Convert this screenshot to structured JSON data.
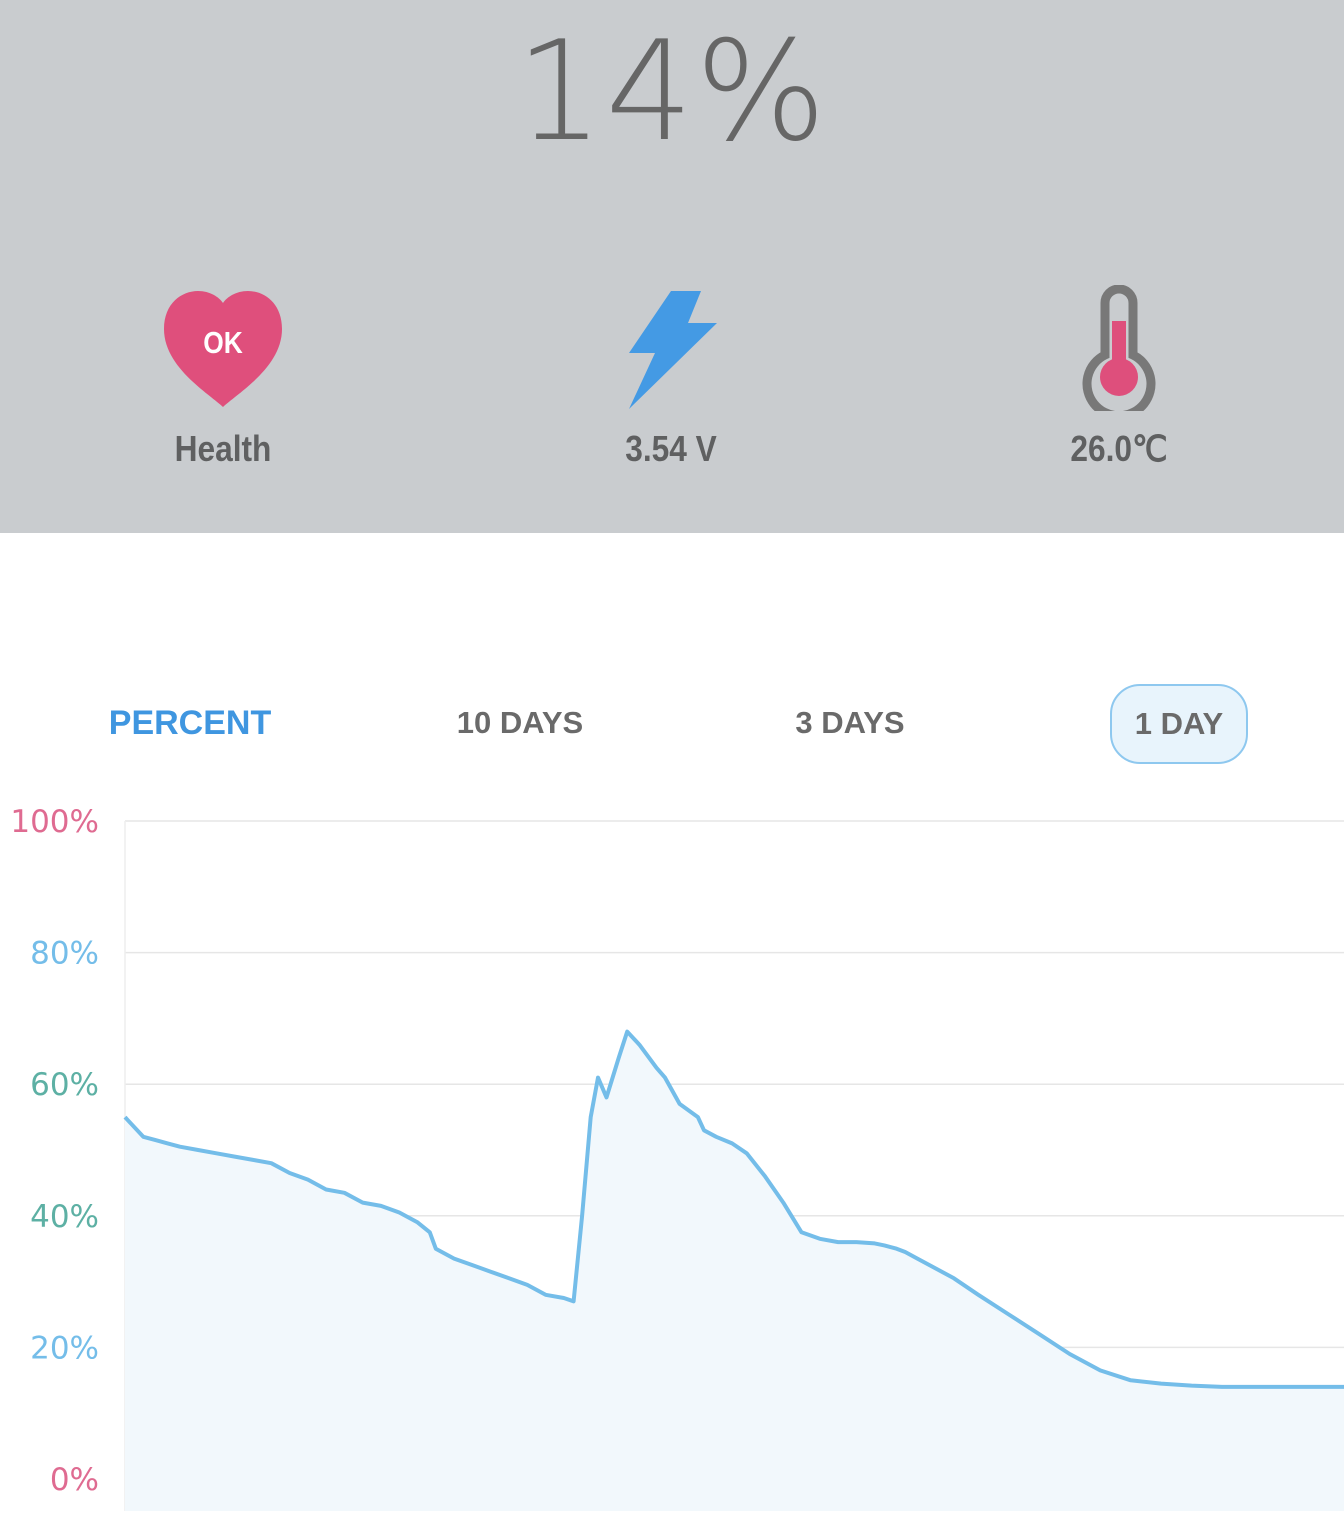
{
  "battery": {
    "percent_text": "14%"
  },
  "stats": {
    "health": {
      "badge": "OK",
      "label": "Health",
      "icon": "heart-icon"
    },
    "voltage": {
      "label": "3.54 V",
      "icon": "lightning-icon"
    },
    "temperature": {
      "label": "26.0℃",
      "icon": "thermometer-icon"
    }
  },
  "tabs": [
    {
      "label": "PERCENT"
    },
    {
      "label": "10 DAYS"
    },
    {
      "label": "3 DAYS"
    },
    {
      "label": "1 DAY",
      "selected": true
    }
  ],
  "colors": {
    "top_bg": "#c9cccf",
    "heart": "#df4f7c",
    "lightning": "#449ae4",
    "thermo_body": "#787878",
    "thermo_fill": "#de4f7c",
    "line": "#74bde9",
    "fill": "#f2f8fc",
    "accent_tab": "#3f96e0"
  },
  "chart_data": {
    "type": "area",
    "y_ticks": [
      {
        "label": "100%",
        "value": 100,
        "color": "#df6b91"
      },
      {
        "label": "80%",
        "value": 80,
        "color": "#74bde9"
      },
      {
        "label": "60%",
        "value": 60,
        "color": "#5db0a4"
      },
      {
        "label": "40%",
        "value": 40,
        "color": "#5db0a4"
      },
      {
        "label": "20%",
        "value": 20,
        "color": "#74bde9"
      },
      {
        "label": "0%",
        "value": 0,
        "color": "#df6b91"
      }
    ],
    "ylim": [
      0,
      100
    ],
    "xlim": [
      0,
      100
    ],
    "grid": true,
    "x": [
      0,
      0.5,
      1.5,
      2.5,
      3.5,
      4.5,
      6,
      7.5,
      9,
      10.5,
      12,
      13.5,
      15,
      16.5,
      18,
      19.5,
      21,
      22.5,
      24,
      25,
      25.5,
      27,
      28.5,
      30,
      31.5,
      33,
      34.5,
      36,
      36.8,
      37.5,
      38.2,
      38.8,
      39.5,
      40.5,
      41.2,
      42.2,
      43,
      43.6,
      44.3,
      45.5,
      47,
      47.5,
      48.5,
      49.8,
      51,
      52.5,
      54,
      55.5,
      57,
      58.5,
      60,
      61.5,
      62.3,
      63.3,
      64,
      65,
      66,
      68,
      70,
      72.5,
      75,
      77.5,
      80,
      82.5,
      85,
      87.5,
      90,
      92.5,
      95,
      97.5,
      100
    ],
    "y": [
      55,
      54,
      52,
      51.5,
      51,
      50.5,
      50,
      49.5,
      49,
      48.5,
      48,
      46.5,
      45.5,
      44,
      43.5,
      42,
      41.5,
      40.5,
      39,
      37.5,
      35,
      33.5,
      32.5,
      31.5,
      30.5,
      29.5,
      28,
      27.5,
      27,
      40,
      55,
      61,
      58,
      64,
      68,
      66,
      64,
      62.5,
      61,
      57,
      55,
      53,
      52,
      51,
      49.5,
      46,
      42,
      37.5,
      36.5,
      36,
      36,
      35.8,
      35.5,
      35,
      34.5,
      33.5,
      32.5,
      30.5,
      28,
      25,
      22,
      19,
      16.5,
      15,
      14.5,
      14.2,
      14,
      14,
      14,
      14,
      14
    ]
  }
}
